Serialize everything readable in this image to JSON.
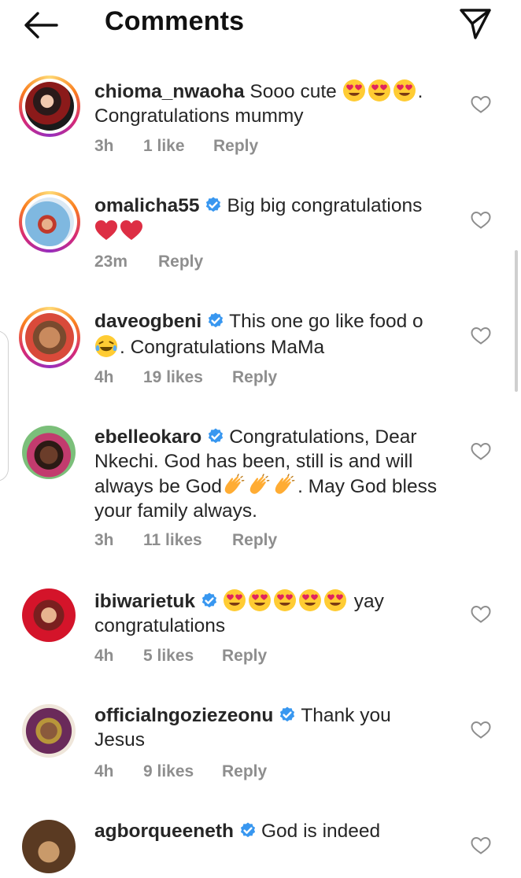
{
  "header": {
    "title": "Comments",
    "back_icon": "arrow-left-icon",
    "send_icon": "paper-plane-icon"
  },
  "reply_label": "Reply",
  "colors": {
    "text": "#262626",
    "meta": "#8e8e8e",
    "verified": "#3897f0"
  },
  "comments": [
    {
      "username": "chioma_nwaoha",
      "verified": false,
      "text_parts": [
        "Sooo cute",
        "."
      ],
      "line2": "Congratulations mummy",
      "time": "3h",
      "likes": "1 like"
    },
    {
      "username": "omalicha55",
      "verified": true,
      "text": "Big big congratulations",
      "time": "23m",
      "likes": ""
    },
    {
      "username": "daveogbeni",
      "verified": true,
      "text": "This one go like food o",
      "line2": ". Congratulations MaMa",
      "time": "4h",
      "likes": "19 likes"
    },
    {
      "username": "ebelleokaro",
      "verified": true,
      "text": "Congratulations, Dear",
      "line2": "Nkechi. God has been, still is and will",
      "line3a": "always be God",
      "line3b": ". May God bless",
      "line4": "your family always.",
      "time": "3h",
      "likes": "11 likes"
    },
    {
      "username": "ibiwarietuk",
      "verified": true,
      "text": "yay",
      "line2": "congratulations",
      "time": "4h",
      "likes": "5 likes"
    },
    {
      "username": "officialngoziezeonu",
      "verified": true,
      "text": "Thank you",
      "line2": "Jesus",
      "time": "4h",
      "likes": "9 likes"
    },
    {
      "username": "agborqueeneth",
      "verified": true,
      "text": "God is indeed"
    }
  ]
}
